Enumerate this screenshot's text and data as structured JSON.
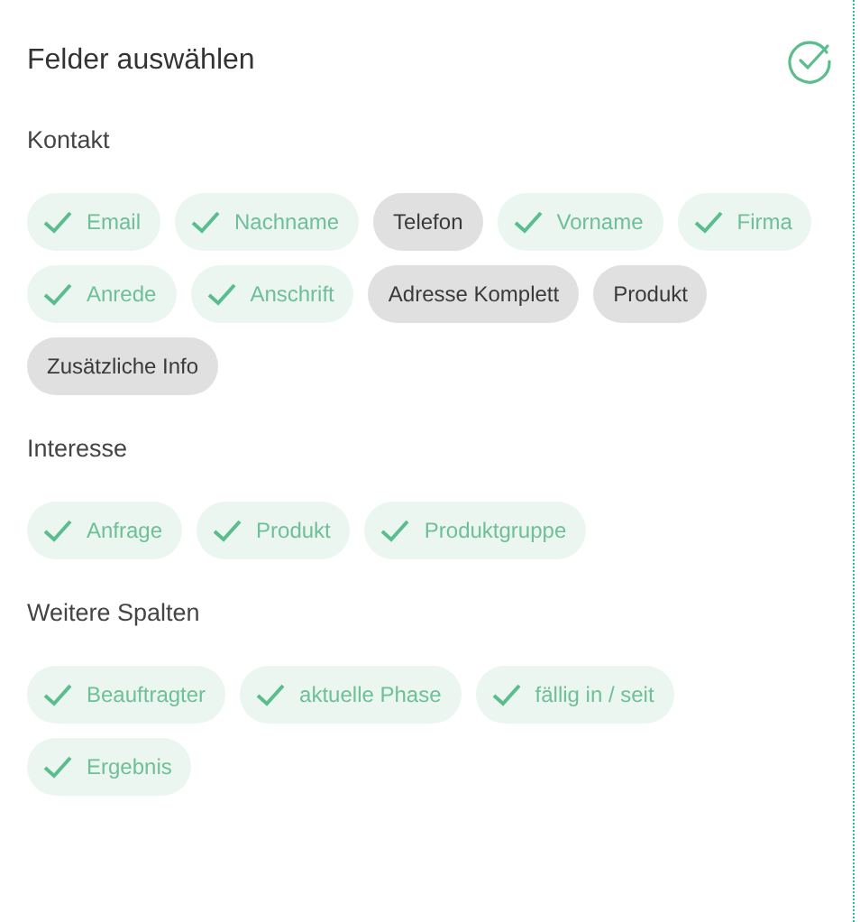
{
  "title": "Felder auswählen",
  "confirmed": true,
  "sections": [
    {
      "heading": "Kontakt",
      "fields": [
        {
          "label": "Email",
          "selected": true
        },
        {
          "label": "Nachname",
          "selected": true
        },
        {
          "label": "Telefon",
          "selected": false
        },
        {
          "label": "Vorname",
          "selected": true
        },
        {
          "label": "Firma",
          "selected": true
        },
        {
          "label": "Anrede",
          "selected": true
        },
        {
          "label": "Anschrift",
          "selected": true
        },
        {
          "label": "Adresse Komplett",
          "selected": false
        },
        {
          "label": "Produkt",
          "selected": false
        },
        {
          "label": "Zusätzliche Info",
          "selected": false
        }
      ]
    },
    {
      "heading": "Interesse",
      "fields": [
        {
          "label": "Anfrage",
          "selected": true
        },
        {
          "label": "Produkt",
          "selected": true
        },
        {
          "label": "Produktgruppe",
          "selected": true
        }
      ]
    },
    {
      "heading": "Weitere Spalten",
      "fields": [
        {
          "label": "Beauftragter",
          "selected": true
        },
        {
          "label": "aktuelle Phase",
          "selected": true
        },
        {
          "label": "fällig in / seit",
          "selected": true
        },
        {
          "label": "Ergebnis",
          "selected": true
        }
      ]
    }
  ]
}
